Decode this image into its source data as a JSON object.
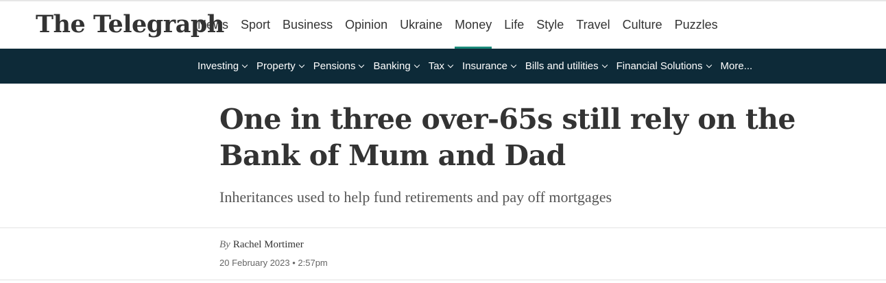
{
  "colors": {
    "accent": "#1a8a7a",
    "dark": "#0d2a38"
  },
  "header": {
    "logo_text": "The Telegraph",
    "nav": [
      "News",
      "Sport",
      "Business",
      "Opinion",
      "Ukraine",
      "Money",
      "Life",
      "Style",
      "Travel",
      "Culture",
      "Puzzles"
    ],
    "active_nav": "Money"
  },
  "subnav": {
    "items": [
      {
        "label": "Investing",
        "has_dropdown": true,
        "icon": "chevron-down-icon"
      },
      {
        "label": "Property",
        "has_dropdown": true,
        "icon": "chevron-down-icon"
      },
      {
        "label": "Pensions",
        "has_dropdown": true,
        "icon": "chevron-down-icon"
      },
      {
        "label": "Banking",
        "has_dropdown": true,
        "icon": "chevron-down-icon"
      },
      {
        "label": "Tax",
        "has_dropdown": true,
        "icon": "chevron-down-icon"
      },
      {
        "label": "Insurance",
        "has_dropdown": true,
        "icon": "chevron-down-icon"
      },
      {
        "label": "Bills and utilities",
        "has_dropdown": true,
        "icon": "chevron-down-icon"
      },
      {
        "label": "Financial Solutions",
        "has_dropdown": true,
        "icon": "chevron-down-icon"
      },
      {
        "label": "More...",
        "has_dropdown": false
      }
    ]
  },
  "article": {
    "headline": "One in three over-65s still rely on the Bank of Mum and Dad",
    "standfirst": "Inheritances used to help fund retirements and pay off mortgages",
    "byline_prefix": "By",
    "author": "Rachel Mortimer",
    "date": "20 February 2023 • 2:57pm"
  }
}
